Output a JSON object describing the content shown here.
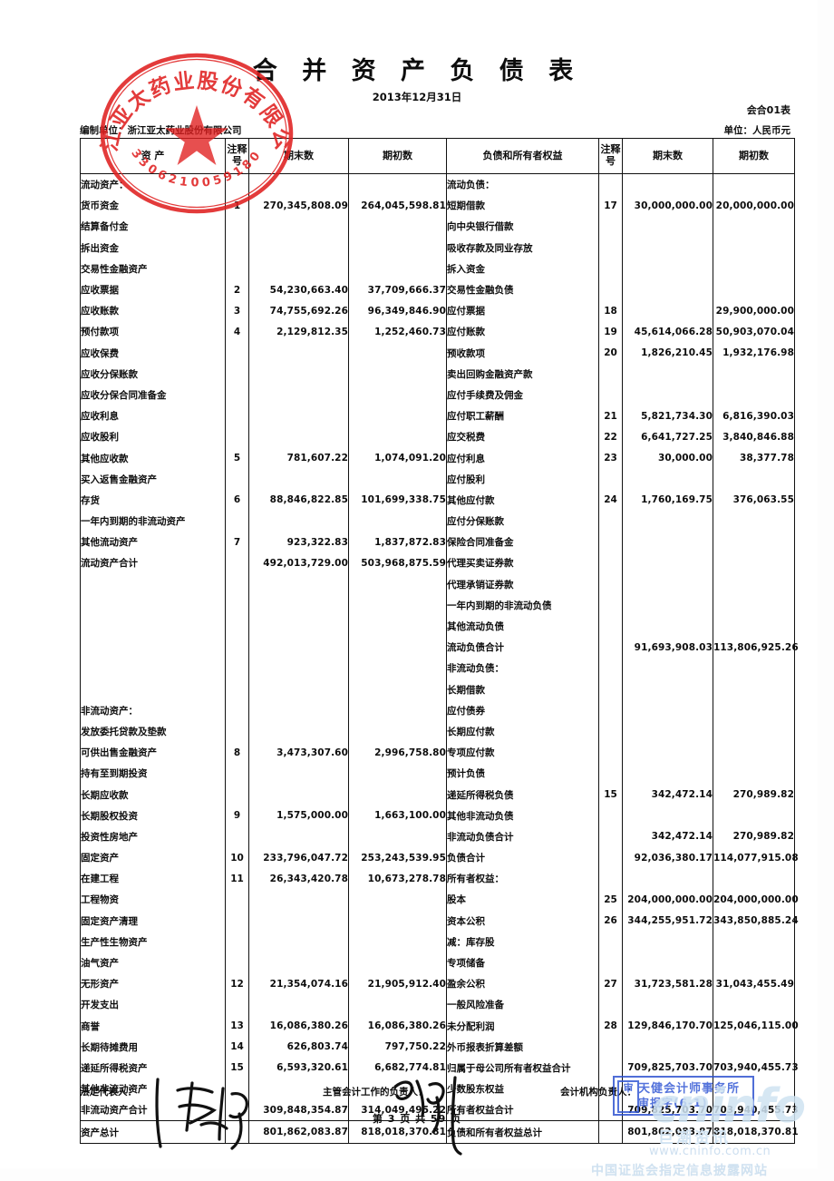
{
  "document": {
    "title": "合 并 资 产 负 债 表",
    "date": "2013年12月31日",
    "form_code": "会合01表",
    "maker": "编制单位：浙江亚太药业股份有限公司",
    "unit": "单位：人民币元",
    "page_number": "第 3 页    共 59 页"
  },
  "seal": {
    "company": "浙江亚太药业股份有限公司",
    "code": "3306210059180",
    "color": "#e02020"
  },
  "audit_stamp": {
    "mark": "审",
    "line1": "天健会计师事务所",
    "line2": "审报字(6-1)",
    "color": "#2f55d4"
  },
  "watermark": {
    "logo": "cninfo",
    "cn": "巨潮资讯",
    "url": "www.cninfo.com.cn",
    "sub": "中国证监会指定信息披露网站",
    "color": "#cfe3f2"
  },
  "table": {
    "headers": {
      "assets": "资  产",
      "note_a": "注释号",
      "end_a": "期末数",
      "begin_a": "期初数",
      "liab": "负债和所有者权益",
      "note_l": "注释号",
      "end_l": "期末数",
      "begin_l": "期初数"
    },
    "assets_rows": [
      {
        "label": "流动资产：",
        "indent": 0,
        "note": "",
        "end": "",
        "begin": ""
      },
      {
        "label": "货币资金",
        "indent": 1,
        "note": "1",
        "end": "270,345,808.09",
        "begin": "264,045,598.81"
      },
      {
        "label": "结算备付金",
        "indent": 1,
        "note": "",
        "end": "",
        "begin": ""
      },
      {
        "label": "拆出资金",
        "indent": 1,
        "note": "",
        "end": "",
        "begin": ""
      },
      {
        "label": "交易性金融资产",
        "indent": 1,
        "note": "",
        "end": "",
        "begin": ""
      },
      {
        "label": "应收票据",
        "indent": 1,
        "note": "2",
        "end": "54,230,663.40",
        "begin": "37,709,666.37"
      },
      {
        "label": "应收账款",
        "indent": 1,
        "note": "3",
        "end": "74,755,692.26",
        "begin": "96,349,846.90"
      },
      {
        "label": "预付款项",
        "indent": 1,
        "note": "4",
        "end": "2,129,812.35",
        "begin": "1,252,460.73"
      },
      {
        "label": "应收保费",
        "indent": 1,
        "note": "",
        "end": "",
        "begin": ""
      },
      {
        "label": "应收分保账款",
        "indent": 1,
        "note": "",
        "end": "",
        "begin": ""
      },
      {
        "label": "应收分保合同准备金",
        "indent": 1,
        "note": "",
        "end": "",
        "begin": ""
      },
      {
        "label": "应收利息",
        "indent": 1,
        "note": "",
        "end": "",
        "begin": ""
      },
      {
        "label": "应收股利",
        "indent": 1,
        "note": "",
        "end": "",
        "begin": ""
      },
      {
        "label": "其他应收款",
        "indent": 1,
        "note": "5",
        "end": "781,607.22",
        "begin": "1,074,091.20"
      },
      {
        "label": "买入返售金融资产",
        "indent": 1,
        "note": "",
        "end": "",
        "begin": ""
      },
      {
        "label": "存货",
        "indent": 1,
        "note": "6",
        "end": "88,846,822.85",
        "begin": "101,699,338.75"
      },
      {
        "label": "一年内到期的非流动资产",
        "indent": 1,
        "note": "",
        "end": "",
        "begin": ""
      },
      {
        "label": "其他流动资产",
        "indent": 1,
        "note": "7",
        "end": "923,322.83",
        "begin": "1,837,872.83"
      },
      {
        "label": "流动资产合计",
        "indent": 2,
        "note": "",
        "end": "492,013,729.00",
        "begin": "503,968,875.59"
      },
      {
        "label": "",
        "indent": 0,
        "note": "",
        "end": "",
        "begin": ""
      },
      {
        "label": "",
        "indent": 0,
        "note": "",
        "end": "",
        "begin": ""
      },
      {
        "label": "",
        "indent": 0,
        "note": "",
        "end": "",
        "begin": ""
      },
      {
        "label": "",
        "indent": 0,
        "note": "",
        "end": "",
        "begin": ""
      },
      {
        "label": "",
        "indent": 0,
        "note": "",
        "end": "",
        "begin": ""
      },
      {
        "label": "",
        "indent": 0,
        "note": "",
        "end": "",
        "begin": ""
      },
      {
        "label": "非流动资产：",
        "indent": 0,
        "note": "",
        "end": "",
        "begin": ""
      },
      {
        "label": "发放委托贷款及垫款",
        "indent": 1,
        "note": "",
        "end": "",
        "begin": ""
      },
      {
        "label": "可供出售金融资产",
        "indent": 1,
        "note": "8",
        "end": "3,473,307.60",
        "begin": "2,996,758.80"
      },
      {
        "label": "持有至到期投资",
        "indent": 1,
        "note": "",
        "end": "",
        "begin": ""
      },
      {
        "label": "长期应收款",
        "indent": 1,
        "note": "",
        "end": "",
        "begin": ""
      },
      {
        "label": "长期股权投资",
        "indent": 1,
        "note": "9",
        "end": "1,575,000.00",
        "begin": "1,663,100.00"
      },
      {
        "label": "投资性房地产",
        "indent": 1,
        "note": "",
        "end": "",
        "begin": ""
      },
      {
        "label": "固定资产",
        "indent": 1,
        "note": "10",
        "end": "233,796,047.72",
        "begin": "253,243,539.95"
      },
      {
        "label": "在建工程",
        "indent": 1,
        "note": "11",
        "end": "26,343,420.78",
        "begin": "10,673,278.78"
      },
      {
        "label": "工程物资",
        "indent": 1,
        "note": "",
        "end": "",
        "begin": ""
      },
      {
        "label": "固定资产清理",
        "indent": 1,
        "note": "",
        "end": "",
        "begin": ""
      },
      {
        "label": "生产性生物资产",
        "indent": 1,
        "note": "",
        "end": "",
        "begin": ""
      },
      {
        "label": "油气资产",
        "indent": 1,
        "note": "",
        "end": "",
        "begin": ""
      },
      {
        "label": "无形资产",
        "indent": 1,
        "note": "12",
        "end": "21,354,074.16",
        "begin": "21,905,912.40"
      },
      {
        "label": "开发支出",
        "indent": 1,
        "note": "",
        "end": "",
        "begin": ""
      },
      {
        "label": "商誉",
        "indent": 1,
        "note": "13",
        "end": "16,086,380.26",
        "begin": "16,086,380.26"
      },
      {
        "label": "长期待摊费用",
        "indent": 1,
        "note": "14",
        "end": "626,803.74",
        "begin": "797,750.22"
      },
      {
        "label": "递延所得税资产",
        "indent": 1,
        "note": "15",
        "end": "6,593,320.61",
        "begin": "6,682,774.81"
      },
      {
        "label": "其他非流动资产",
        "indent": 1,
        "note": "",
        "end": "",
        "begin": ""
      },
      {
        "label": "非流动资产合计",
        "indent": 2,
        "note": "",
        "end": "309,848,354.87",
        "begin": "314,049,495.22"
      }
    ],
    "assets_total": {
      "label": "资产总计",
      "note": "",
      "end": "801,862,083.87",
      "begin": "818,018,370.81"
    },
    "liab_rows": [
      {
        "label": "流动负债：",
        "indent": 0,
        "note": "",
        "end": "",
        "begin": ""
      },
      {
        "label": "短期借款",
        "indent": 1,
        "note": "17",
        "end": "30,000,000.00",
        "begin": "20,000,000.00"
      },
      {
        "label": "向中央银行借款",
        "indent": 1,
        "note": "",
        "end": "",
        "begin": ""
      },
      {
        "label": "吸收存款及同业存放",
        "indent": 1,
        "note": "",
        "end": "",
        "begin": ""
      },
      {
        "label": "拆入资金",
        "indent": 1,
        "note": "",
        "end": "",
        "begin": ""
      },
      {
        "label": "交易性金融负债",
        "indent": 1,
        "note": "",
        "end": "",
        "begin": ""
      },
      {
        "label": "应付票据",
        "indent": 1,
        "note": "18",
        "end": "",
        "begin": "29,900,000.00"
      },
      {
        "label": "应付账款",
        "indent": 1,
        "note": "19",
        "end": "45,614,066.28",
        "begin": "50,903,070.04"
      },
      {
        "label": "预收款项",
        "indent": 1,
        "note": "20",
        "end": "1,826,210.45",
        "begin": "1,932,176.98"
      },
      {
        "label": "卖出回购金融资产款",
        "indent": 1,
        "note": "",
        "end": "",
        "begin": ""
      },
      {
        "label": "应付手续费及佣金",
        "indent": 1,
        "note": "",
        "end": "",
        "begin": ""
      },
      {
        "label": "应付职工薪酬",
        "indent": 1,
        "note": "21",
        "end": "5,821,734.30",
        "begin": "6,816,390.03"
      },
      {
        "label": "应交税费",
        "indent": 1,
        "note": "22",
        "end": "6,641,727.25",
        "begin": "3,840,846.88"
      },
      {
        "label": "应付利息",
        "indent": 1,
        "note": "23",
        "end": "30,000.00",
        "begin": "38,377.78"
      },
      {
        "label": "应付股利",
        "indent": 1,
        "note": "",
        "end": "",
        "begin": ""
      },
      {
        "label": "其他应付款",
        "indent": 1,
        "note": "24",
        "end": "1,760,169.75",
        "begin": "376,063.55"
      },
      {
        "label": "应付分保账款",
        "indent": 1,
        "note": "",
        "end": "",
        "begin": ""
      },
      {
        "label": "保险合同准备金",
        "indent": 1,
        "note": "",
        "end": "",
        "begin": ""
      },
      {
        "label": "代理买卖证券款",
        "indent": 1,
        "note": "",
        "end": "",
        "begin": ""
      },
      {
        "label": "代理承销证券款",
        "indent": 1,
        "note": "",
        "end": "",
        "begin": ""
      },
      {
        "label": "一年内到期的非流动负债",
        "indent": 1,
        "note": "",
        "end": "",
        "begin": ""
      },
      {
        "label": "其他流动负债",
        "indent": 1,
        "note": "",
        "end": "",
        "begin": ""
      },
      {
        "label": "流动负债合计",
        "indent": 2,
        "note": "",
        "end": "91,693,908.03",
        "begin": "113,806,925.26"
      },
      {
        "label": "非流动负债：",
        "indent": 0,
        "note": "",
        "end": "",
        "begin": ""
      },
      {
        "label": "长期借款",
        "indent": 1,
        "note": "",
        "end": "",
        "begin": ""
      },
      {
        "label": "应付债券",
        "indent": 1,
        "note": "",
        "end": "",
        "begin": ""
      },
      {
        "label": "长期应付款",
        "indent": 1,
        "note": "",
        "end": "",
        "begin": ""
      },
      {
        "label": "专项应付款",
        "indent": 1,
        "note": "",
        "end": "",
        "begin": ""
      },
      {
        "label": "预计负债",
        "indent": 1,
        "note": "",
        "end": "",
        "begin": ""
      },
      {
        "label": "递延所得税负债",
        "indent": 1,
        "note": "15",
        "end": "342,472.14",
        "begin": "270,989.82"
      },
      {
        "label": "其他非流动负债",
        "indent": 1,
        "note": "",
        "end": "",
        "begin": ""
      },
      {
        "label": "非流动负债合计",
        "indent": 2,
        "note": "",
        "end": "342,472.14",
        "begin": "270,989.82"
      },
      {
        "label": "负债合计",
        "indent": 3,
        "note": "",
        "end": "92,036,380.17",
        "begin": "114,077,915.08"
      },
      {
        "label": "所有者权益：",
        "indent": 0,
        "note": "",
        "end": "",
        "begin": ""
      },
      {
        "label": "股本",
        "indent": 1,
        "note": "25",
        "end": "204,000,000.00",
        "begin": "204,000,000.00"
      },
      {
        "label": "资本公积",
        "indent": 1,
        "note": "26",
        "end": "344,255,951.72",
        "begin": "343,850,885.24"
      },
      {
        "label": "减：库存股",
        "indent": 1,
        "note": "",
        "end": "",
        "begin": ""
      },
      {
        "label": "专项储备",
        "indent": 1,
        "note": "",
        "end": "",
        "begin": ""
      },
      {
        "label": "盈余公积",
        "indent": 1,
        "note": "27",
        "end": "31,723,581.28",
        "begin": "31,043,455.49"
      },
      {
        "label": "一般风险准备",
        "indent": 1,
        "note": "",
        "end": "",
        "begin": ""
      },
      {
        "label": "未分配利润",
        "indent": 1,
        "note": "28",
        "end": "129,846,170.70",
        "begin": "125,046,115.00"
      },
      {
        "label": "外币报表折算差额",
        "indent": 1,
        "note": "",
        "end": "",
        "begin": ""
      },
      {
        "label": "归属于母公司所有者权益合计",
        "indent": 1,
        "note": "",
        "end": "709,825,703.70",
        "begin": "703,940,455.73"
      },
      {
        "label": "少数股东权益",
        "indent": 1,
        "note": "",
        "end": "",
        "begin": ""
      },
      {
        "label": "所有者权益合计",
        "indent": 2,
        "note": "",
        "end": "709,825,703.70",
        "begin": "703,940,455.73"
      }
    ],
    "liab_total": {
      "label": "负债和所有者权益总计",
      "note": "",
      "end": "801,862,083.87",
      "begin": "818,018,370.81"
    }
  },
  "footer": {
    "legal_rep": "法定代表人：",
    "accounting_head": "主管会计工作的负责人：",
    "institution_head": "会计机构负责人："
  }
}
